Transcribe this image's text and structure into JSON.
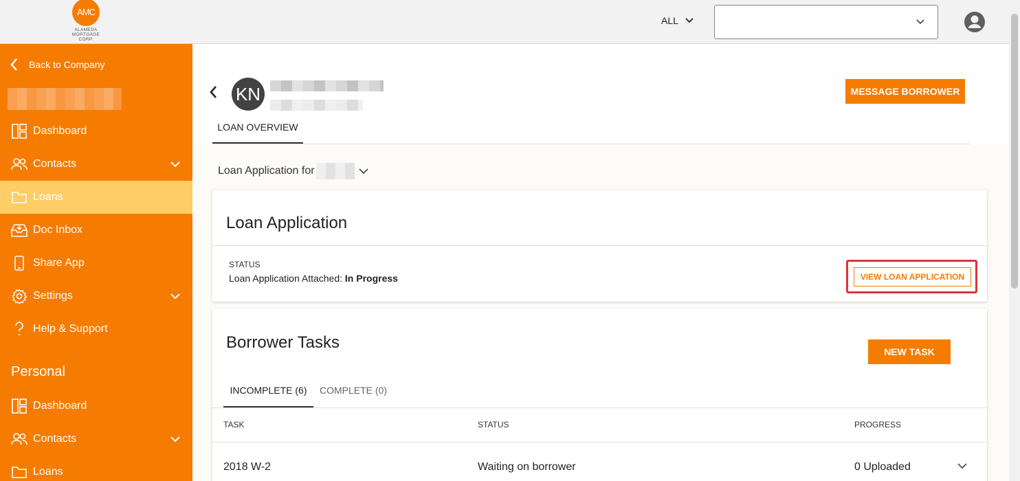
{
  "topbar": {
    "logo_initials": "AMC",
    "logo_lines": [
      "ALAMEDA",
      "MORTGAGE",
      "CORP."
    ],
    "filter_label": "ALL",
    "company_select_value": ""
  },
  "sidebar": {
    "back_label": "Back to Company",
    "company_items": [
      {
        "label": "Dashboard",
        "icon": "dashboard-icon"
      },
      {
        "label": "Contacts",
        "icon": "contacts-icon",
        "expandable": true
      },
      {
        "label": "Loans",
        "icon": "folder-icon",
        "active": true
      },
      {
        "label": "Doc Inbox",
        "icon": "inbox-icon"
      },
      {
        "label": "Share App",
        "icon": "phone-icon"
      },
      {
        "label": "Settings",
        "icon": "gear-icon",
        "expandable": true
      },
      {
        "label": "Help & Support",
        "icon": "help-icon"
      }
    ],
    "personal_title": "Personal",
    "personal_items": [
      {
        "label": "Dashboard",
        "icon": "dashboard-icon"
      },
      {
        "label": "Contacts",
        "icon": "contacts-icon",
        "expandable": true
      },
      {
        "label": "Loans",
        "icon": "folder-icon"
      }
    ]
  },
  "header": {
    "avatar_initials": "KN",
    "message_button": "MESSAGE BORROWER",
    "tab_overview": "LOAN OVERVIEW"
  },
  "loan_select": {
    "prefix": "Loan Application for"
  },
  "loan_card": {
    "title": "Loan Application",
    "status_label": "STATUS",
    "status_prefix": "Loan Application Attached:",
    "status_value": "In Progress",
    "view_button": "VIEW LOAN APPLICATION"
  },
  "tasks_card": {
    "title": "Borrower Tasks",
    "new_task_button": "NEW TASK",
    "tabs": [
      {
        "label": "INCOMPLETE (6)",
        "active": true
      },
      {
        "label": "COMPLETE (0)",
        "active": false
      }
    ],
    "columns": [
      "TASK",
      "STATUS",
      "PROGRESS"
    ],
    "rows": [
      {
        "task": "2018 W-2",
        "status": "Waiting on borrower",
        "progress": "0 Uploaded"
      }
    ]
  },
  "colors": {
    "brand_orange": "#f57c00",
    "active_nav": "#ffcd66",
    "highlight_red": "#e0323c"
  }
}
